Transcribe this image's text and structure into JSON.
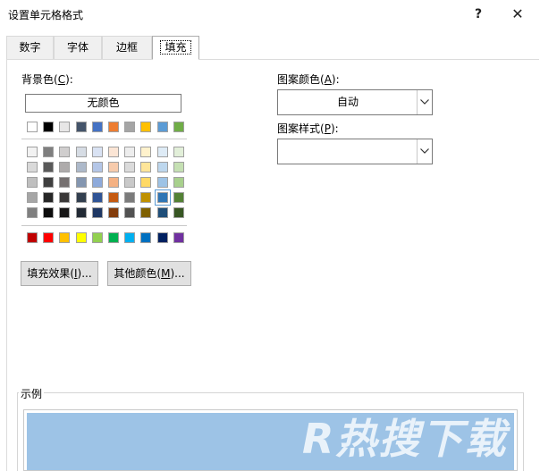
{
  "window": {
    "title": "设置单元格格式",
    "help": "?",
    "close": "✕"
  },
  "tabs": [
    "数字",
    "字体",
    "边框",
    "填充"
  ],
  "active_tab": "填充",
  "background": {
    "label_pre": "背景色(",
    "label_key": "C",
    "label_post": "):",
    "no_color": "无颜色",
    "theme_top": [
      "#ffffff",
      "#000000",
      "#e7e6e6",
      "#44546a",
      "#4472c4",
      "#ed7d31",
      "#a5a5a5",
      "#ffc000",
      "#5b9bd5",
      "#70ad47"
    ],
    "theme_shades": [
      [
        "#f2f2f2",
        "#7f7f7f",
        "#d0cece",
        "#d6dce4",
        "#d9e2f3",
        "#fbe5d5",
        "#ededed",
        "#fff2cc",
        "#deebf6",
        "#e2efd9"
      ],
      [
        "#d9d9d9",
        "#595959",
        "#aeabab",
        "#adb9ca",
        "#b4c6e7",
        "#f7cbac",
        "#dbdbdb",
        "#fee599",
        "#bdd7ee",
        "#c5e0b3"
      ],
      [
        "#bfbfbf",
        "#3f3f3f",
        "#757070",
        "#8496b0",
        "#8eaadb",
        "#f4b183",
        "#c9c9c9",
        "#ffd965",
        "#9dc3e6",
        "#a8d08d"
      ],
      [
        "#a6a6a6",
        "#262626",
        "#3a3838",
        "#323f4f",
        "#2f5496",
        "#c55a11",
        "#7b7b7b",
        "#bf9000",
        "#2e75b5",
        "#538135"
      ],
      [
        "#7f7f7f",
        "#0c0c0c",
        "#171616",
        "#222a35",
        "#1f3864",
        "#833c0b",
        "#525252",
        "#7f6000",
        "#1f4e79",
        "#375623"
      ]
    ],
    "standard": [
      "#c00000",
      "#ff0000",
      "#ffc000",
      "#ffff00",
      "#92d050",
      "#00b050",
      "#00b0f0",
      "#0070c0",
      "#002060",
      "#7030a0"
    ],
    "selected_swatch": "row3-col9"
  },
  "buttons": {
    "fill_effects_pre": "填充效果(",
    "fill_effects_key": "I",
    "fill_effects_post": ")...",
    "more_colors_pre": "其他颜色(",
    "more_colors_key": "M",
    "more_colors_post": ")..."
  },
  "pattern": {
    "color_label_pre": "图案颜色(",
    "color_label_key": "A",
    "color_label_post": "):",
    "color_value": "自动",
    "style_label_pre": "图案样式(",
    "style_label_key": "P",
    "style_label_post": "):",
    "style_value": ""
  },
  "sample": {
    "label": "示例",
    "fill_color": "#9dc3e6"
  },
  "watermark": "R热搜下载"
}
